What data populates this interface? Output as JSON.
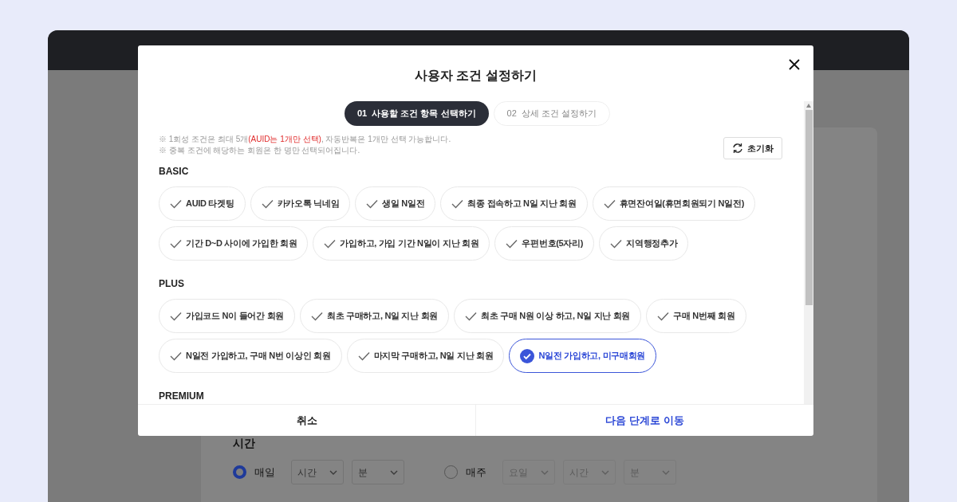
{
  "background": {
    "time_section": {
      "label": "시간",
      "options": [
        {
          "label": "매일",
          "selected": true,
          "selects": [
            {
              "placeholder": "시간",
              "disabled": false
            },
            {
              "placeholder": "분",
              "disabled": false
            }
          ]
        },
        {
          "label": "매주",
          "selected": false,
          "selects": [
            {
              "placeholder": "요일",
              "disabled": true
            },
            {
              "placeholder": "시간",
              "disabled": true
            },
            {
              "placeholder": "분",
              "disabled": true
            }
          ]
        }
      ]
    }
  },
  "modal": {
    "title": "사용자 조건 설정하기",
    "steps": [
      {
        "label": "01  사용할 조건 항목 선택하기",
        "selected": true
      },
      {
        "label": "02  상세 조건 설정하기",
        "selected": false
      }
    ],
    "notes": [
      [
        {
          "text": "※ 1회성 조건은 최대 5개",
          "highlight": false
        },
        {
          "text": "(AUID는 1개만 선택)",
          "highlight": true
        },
        {
          "text": ", 자동반복은 1개만 선택 가능합니다.",
          "highlight": false
        }
      ],
      [
        {
          "text": "※ 중복 조건에 해당하는 회원은 한 명만 선택되어집니다.",
          "highlight": false
        }
      ]
    ],
    "reset_button": "초기화",
    "sections": [
      {
        "title": "BASIC",
        "items": [
          {
            "label": "AUID 타겟팅",
            "selected": false
          },
          {
            "label": "카카오톡 닉네임",
            "selected": false
          },
          {
            "label": "생일 N일전",
            "selected": false
          },
          {
            "label": "최종 접속하고 N일 지난 회원",
            "selected": false
          },
          {
            "label": "휴면잔여일(휴면회원되기 N일전)",
            "selected": false
          },
          {
            "label": "기간 D~D 사이에 가입한 회원",
            "selected": false
          },
          {
            "label": "가입하고, 가입 기간 N일이 지난 회원",
            "selected": false
          },
          {
            "label": "우편번호(5자리)",
            "selected": false
          },
          {
            "label": "지역행정추가",
            "selected": false
          }
        ]
      },
      {
        "title": "PLUS",
        "items": [
          {
            "label": "가입코드 N이 들어간 회원",
            "selected": false
          },
          {
            "label": "최초 구매하고, N일 지난 회원",
            "selected": false
          },
          {
            "label": "최초 구매 N원 이상 하고, N일 지난 회원",
            "selected": false
          },
          {
            "label": "구매 N번째 회원",
            "selected": false
          },
          {
            "label": "N일전 가입하고, 구매 N번 이상인 회원",
            "selected": false
          },
          {
            "label": "마지막 구매하고, N일 지난 회원",
            "selected": false
          },
          {
            "label": "N일전 가입하고, 미구매회원",
            "selected": true
          }
        ]
      },
      {
        "title": "PREMIUM"
      }
    ],
    "buttons": [
      {
        "label": "취소",
        "kind": "cancel"
      },
      {
        "label": "다음 단계로 이동",
        "kind": "primary"
      }
    ]
  }
}
